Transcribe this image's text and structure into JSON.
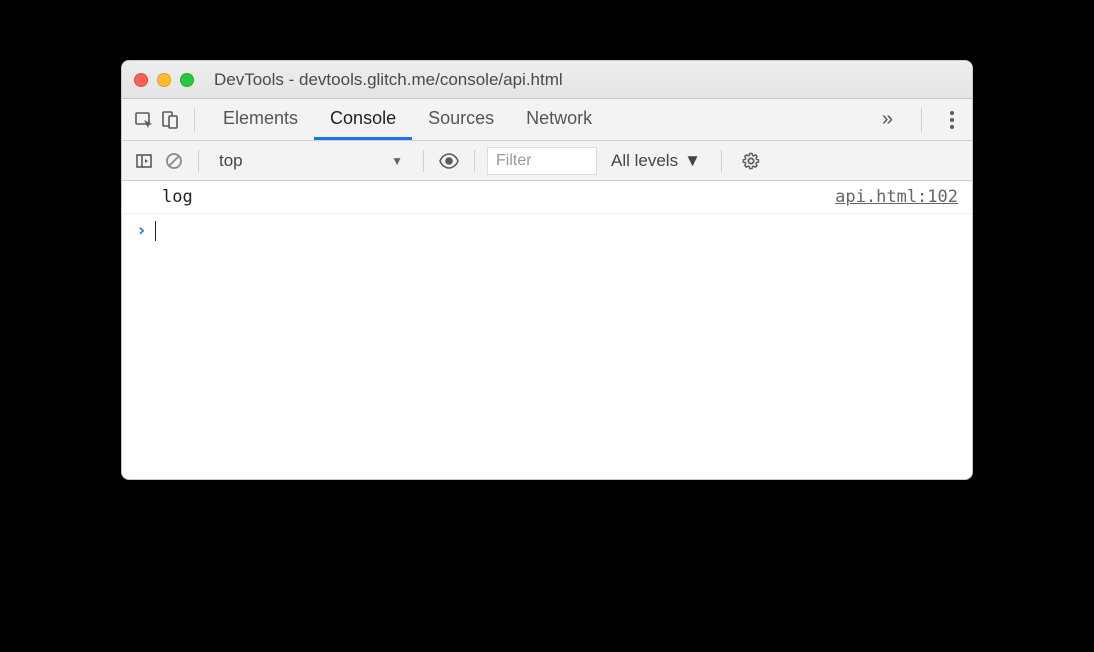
{
  "window": {
    "title": "DevTools - devtools.glitch.me/console/api.html"
  },
  "tabs": {
    "elements": "Elements",
    "console": "Console",
    "sources": "Sources",
    "network": "Network",
    "active": "console"
  },
  "consoleBar": {
    "context": "top",
    "filterPlaceholder": "Filter",
    "levels": "All levels"
  },
  "log": {
    "message": "log",
    "source": "api.html:102"
  }
}
